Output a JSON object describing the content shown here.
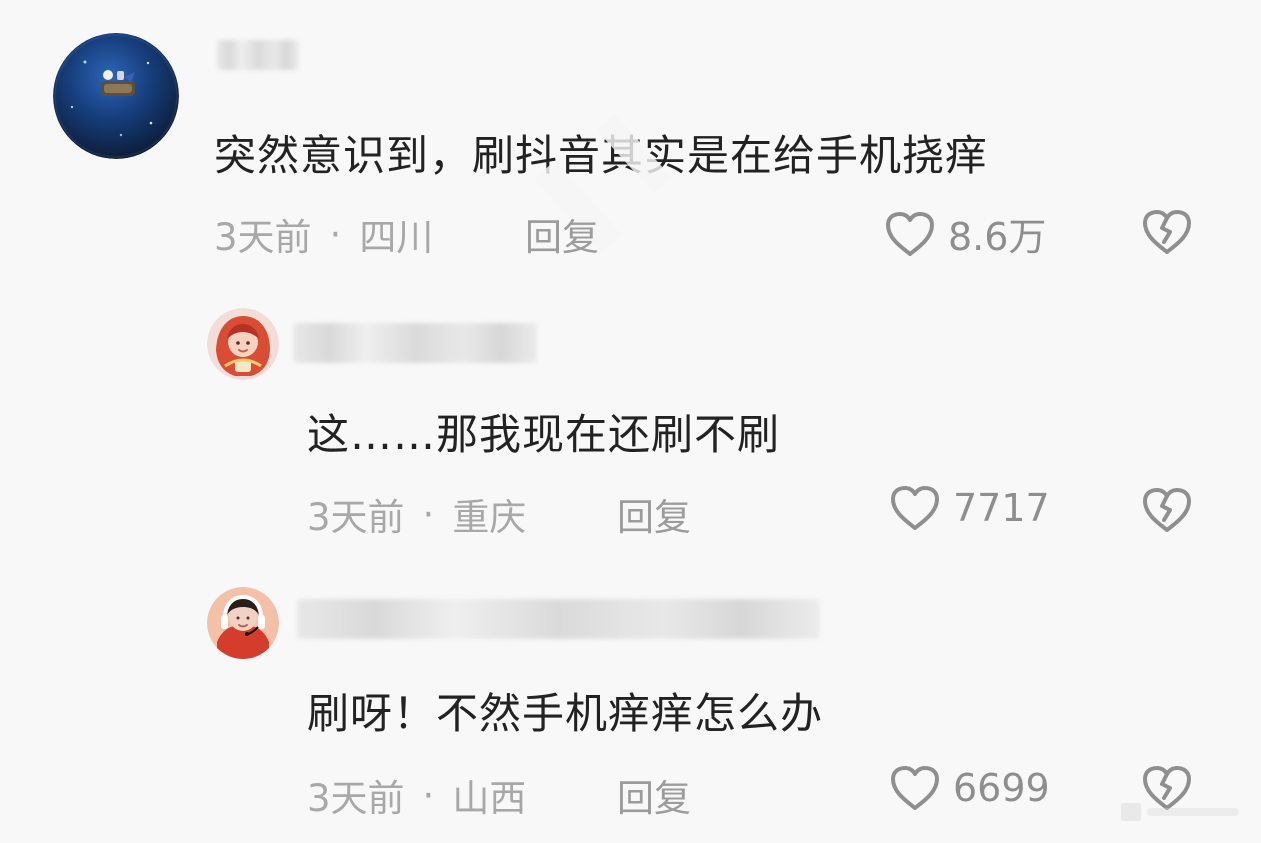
{
  "comments": [
    {
      "text": "突然意识到，刷抖音其实是在给手机挠痒",
      "time": "3天前",
      "location": "四川",
      "reply": "回复",
      "likes": "8.6万",
      "avatar_icon": "moon-cat-avatar-icon"
    },
    {
      "text": "这……那我现在还刷不刷",
      "time": "3天前",
      "location": "重庆",
      "reply": "回复",
      "likes": "7717",
      "avatar_icon": "anime-girl-avatar-icon"
    },
    {
      "text": "刷呀！不然手机痒痒怎么办",
      "time": "3天前",
      "location": "山西",
      "reply": "回复",
      "likes": "6699",
      "avatar_icon": "headset-girl-avatar-icon"
    }
  ],
  "icons": {
    "like": "heart-outline-icon",
    "dislike": "broken-heart-icon"
  },
  "colors": {
    "background": "#f8f8f8",
    "text": "#222222",
    "meta": "#a8a8a8",
    "icon": "#8e8e8e"
  }
}
